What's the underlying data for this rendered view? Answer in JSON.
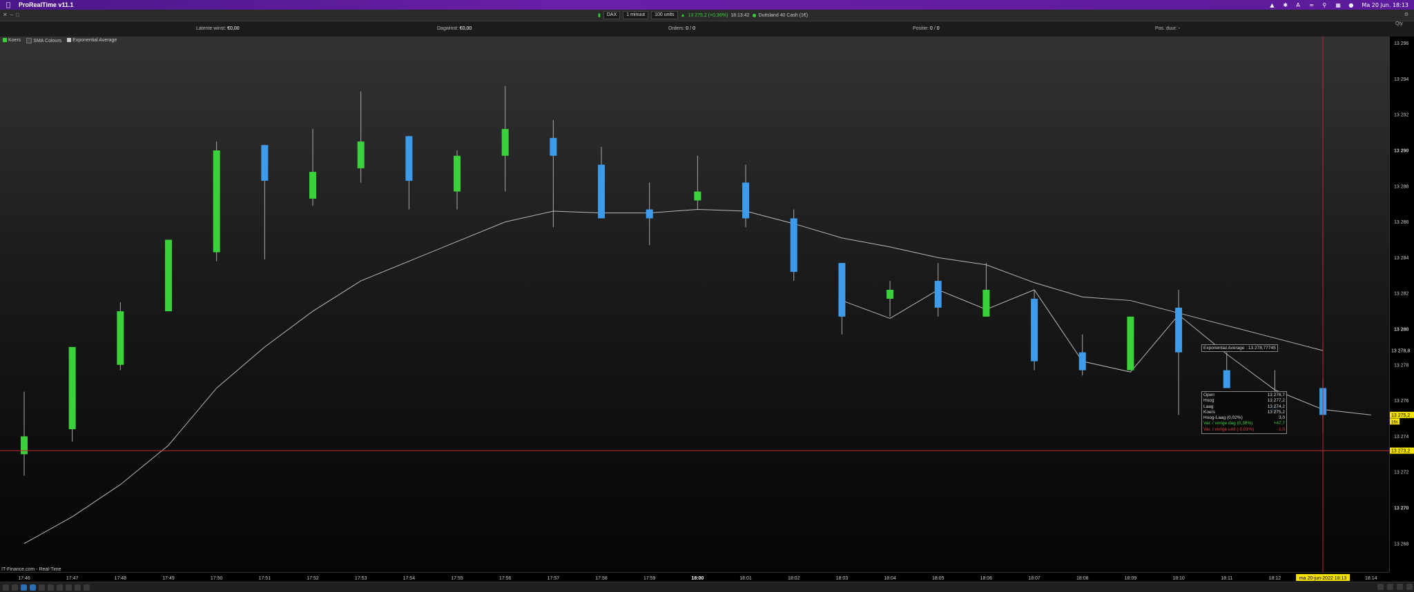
{
  "menubar": {
    "app_name": "ProRealTime v11.1",
    "clock": "Ma 20 jun. 18:13"
  },
  "toolbar": {
    "instrument": "DAX",
    "timeframe": "1 minuut",
    "units": "100 units",
    "price_change": "13 275,2 (+0,36%)",
    "time": "18:13:42",
    "market": "Duitsland 40 Cash (1€)"
  },
  "infobar": {
    "latent_label": "Latente winst:",
    "latent_value": "€0,00",
    "day_label": "Dagwinst:",
    "day_value": "€0,00",
    "orders_label": "Orders:",
    "orders_value": "0",
    "orders_sep": "/",
    "orders_value2": "0",
    "position_label": "Positie:",
    "position_value": "0",
    "position_sep": "/",
    "position_value2": "0",
    "duration_label": "Pos. duur:",
    "duration_value": "-"
  },
  "legend": {
    "items": [
      {
        "label": "Koers",
        "color": "#3bd13b"
      },
      {
        "label": "SMA Colours",
        "color": "#444444"
      },
      {
        "label": "Exponential Average",
        "color": "#cccccc"
      }
    ]
  },
  "y_axis": {
    "qty_label": "Qty",
    "ticks": [
      "13 296",
      "13 294",
      "13 292",
      "13 290",
      "13 288",
      "13 286",
      "13 284",
      "13 282",
      "13 280",
      "13 278",
      "13 276",
      "13 274",
      "13 272",
      "13 270",
      "13 268"
    ],
    "ema_label": "13 278,8",
    "price_label": "13 275,2",
    "price_sub": "16s",
    "crosshair_label": "13 273,2"
  },
  "x_axis": {
    "ticks": [
      "17:46",
      "17:47",
      "17:48",
      "17:49",
      "17:50",
      "17:51",
      "17:52",
      "17:53",
      "17:54",
      "17:55",
      "17:56",
      "17:57",
      "17:58",
      "17:59",
      "18:00",
      "18:01",
      "18:02",
      "18:03",
      "18:04",
      "18:05",
      "18:06",
      "18:07",
      "18:08",
      "18:09",
      "18:10",
      "18:11",
      "18:12",
      "18:13",
      "18:14"
    ],
    "crosshair_label": "ma 20-jun-2022 18:13"
  },
  "source_label": "IT-Finance.com - Real-Time",
  "ema_tooltip": "Exponential Average : 13 278,77745",
  "ohlc_tooltip": [
    {
      "label": "Open",
      "value": "13 276,7",
      "color": "#dddddd"
    },
    {
      "label": "Hoog",
      "value": "13 277,2",
      "color": "#dddddd"
    },
    {
      "label": "Laag",
      "value": "13 274,2",
      "color": "#dddddd"
    },
    {
      "label": "Koers",
      "value": "13 275,2",
      "color": "#dddddd"
    },
    {
      "label": "Hoog-Laag (0,02%)",
      "value": "3,0",
      "color": "#dddddd"
    },
    {
      "label": "Var. / vorige dag (0,36%)",
      "value": "+47,7",
      "color": "#3bd13b"
    },
    {
      "label": "Var. / vorige unit (-0,01%)",
      "value": "-1,0",
      "color": "#e04040"
    }
  ],
  "colors": {
    "up": "#3bd13b",
    "down": "#3d9be9",
    "ema": "#b8b8b8",
    "crosshair": "#c0282d",
    "highlight": "#f5e200"
  },
  "chart_data": {
    "type": "candlestick",
    "y_range": [
      13267,
      13297
    ],
    "candles": [
      {
        "t": "17:46",
        "o": 13273.0,
        "h": 13276.5,
        "l": 13271.8,
        "c": 13274.0
      },
      {
        "t": "17:47",
        "o": 13274.4,
        "h": 13279.0,
        "l": 13273.7,
        "c": 13279.0
      },
      {
        "t": "17:48",
        "o": 13278.0,
        "h": 13281.5,
        "l": 13277.7,
        "c": 13281.0
      },
      {
        "t": "17:49",
        "o": 13281.0,
        "h": 13285.0,
        "l": 13281.0,
        "c": 13285.0
      },
      {
        "t": "17:50",
        "o": 13284.3,
        "h": 13290.5,
        "l": 13283.8,
        "c": 13290.0
      },
      {
        "t": "17:51",
        "o": 13290.3,
        "h": 13290.3,
        "l": 13283.9,
        "c": 13288.3
      },
      {
        "t": "17:52",
        "o": 13287.3,
        "h": 13291.2,
        "l": 13286.9,
        "c": 13288.8
      },
      {
        "t": "17:53",
        "o": 13289.0,
        "h": 13293.3,
        "l": 13288.2,
        "c": 13290.5
      },
      {
        "t": "17:54",
        "o": 13290.8,
        "h": 13290.8,
        "l": 13286.7,
        "c": 13288.3
      },
      {
        "t": "17:55",
        "o": 13287.7,
        "h": 13290.0,
        "l": 13286.7,
        "c": 13289.7
      },
      {
        "t": "17:56",
        "o": 13289.7,
        "h": 13293.6,
        "l": 13287.7,
        "c": 13291.2
      },
      {
        "t": "17:57",
        "o": 13290.7,
        "h": 13291.7,
        "l": 13285.7,
        "c": 13289.7
      },
      {
        "t": "17:58",
        "o": 13289.2,
        "h": 13290.2,
        "l": 13286.2,
        "c": 13286.2
      },
      {
        "t": "17:59",
        "o": 13286.7,
        "h": 13288.2,
        "l": 13284.7,
        "c": 13286.2
      },
      {
        "t": "18:00",
        "o": 13287.2,
        "h": 13289.7,
        "l": 13286.7,
        "c": 13287.7
      },
      {
        "t": "18:01",
        "o": 13288.2,
        "h": 13289.2,
        "l": 13285.7,
        "c": 13286.2
      },
      {
        "t": "18:02",
        "o": 13286.2,
        "h": 13286.7,
        "l": 13282.7,
        "c": 13283.2
      },
      {
        "t": "18:03",
        "o": 13283.7,
        "h": 13283.7,
        "l": 13279.7,
        "c": 13280.7
      },
      {
        "t": "18:04",
        "o": 13281.7,
        "h": 13282.7,
        "l": 13280.7,
        "c": 13282.2
      },
      {
        "t": "18:05",
        "o": 13282.7,
        "h": 13283.7,
        "l": 13280.7,
        "c": 13281.2
      },
      {
        "t": "18:06",
        "o": 13280.7,
        "h": 13283.7,
        "l": 13280.7,
        "c": 13282.2
      },
      {
        "t": "18:07",
        "o": 13281.7,
        "h": 13282.2,
        "l": 13277.7,
        "c": 13278.2
      },
      {
        "t": "18:08",
        "o": 13278.7,
        "h": 13279.7,
        "l": 13277.4,
        "c": 13277.7
      },
      {
        "t": "18:09",
        "o": 13277.7,
        "h": 13280.7,
        "l": 13277.7,
        "c": 13280.7
      },
      {
        "t": "18:10",
        "o": 13281.2,
        "h": 13282.2,
        "l": 13275.2,
        "c": 13278.7
      },
      {
        "t": "18:11",
        "o": 13277.7,
        "h": 13278.7,
        "l": 13276.7,
        "c": 13276.7
      },
      {
        "t": "18:12",
        "o": 13275.7,
        "h": 13277.7,
        "l": 13275.2,
        "c": 13275.4
      },
      {
        "t": "18:13",
        "o": 13276.7,
        "h": 13277.2,
        "l": 13274.2,
        "c": 13275.2
      }
    ],
    "ema": [
      13268.0,
      13269.5,
      13271.3,
      13273.5,
      13276.7,
      13279.0,
      13281.0,
      13282.7,
      13283.8,
      13284.9,
      13286.0,
      13286.6,
      13286.5,
      13286.5,
      13286.7,
      13286.6,
      13285.9,
      13285.1,
      13284.6,
      13284.0,
      13283.6,
      13282.6,
      13281.8,
      13281.6,
      13280.9,
      13280.2,
      13279.5,
      13278.8
    ],
    "close_line": [
      13281.6,
      13280.6,
      13282.2,
      13281.1,
      13282.2,
      13278.2,
      13277.6,
      13280.8,
      13278.6,
      13276.6,
      13275.5,
      13275.2
    ],
    "close_line_start": "18:03",
    "crosshair_y": 13273.2
  }
}
